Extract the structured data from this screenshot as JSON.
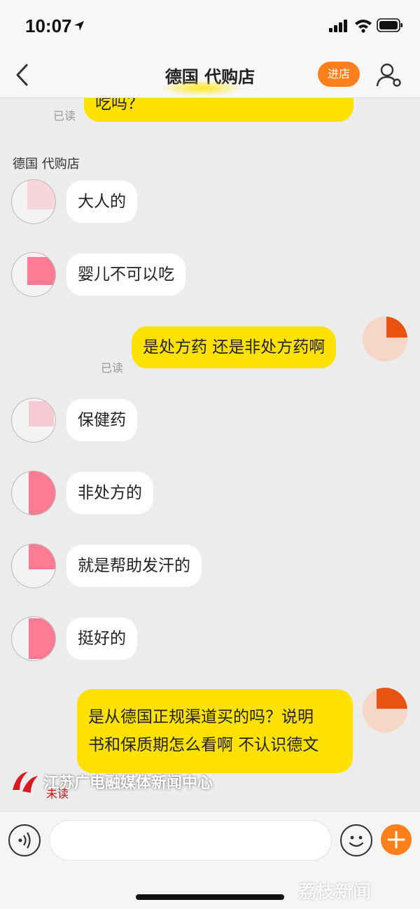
{
  "status_bar": {
    "time": "10:07"
  },
  "nav": {
    "title": "德国 代购店",
    "enter_store": "进店"
  },
  "chat": {
    "top_partial_text": "吃吗？",
    "read_label": "已读",
    "unread_label": "未读",
    "sender_name": "德国 代购店",
    "messages": [
      {
        "side": "in",
        "text": "大人的"
      },
      {
        "side": "in",
        "text": "婴儿不可以吃"
      },
      {
        "side": "out",
        "text": "是处方药 还是非处方药啊",
        "status": "已读"
      },
      {
        "side": "in",
        "text": "保健药"
      },
      {
        "side": "in",
        "text": "非处方的"
      },
      {
        "side": "in",
        "text": "就是帮助发汗的"
      },
      {
        "side": "in",
        "text": "挺好的"
      },
      {
        "side": "out",
        "text_line1": "是从德国正规渠道买的吗？说明",
        "text_line2": "书和保质期怎么看啊 不认识德文",
        "status": "未读"
      }
    ]
  },
  "watermark": {
    "text": "江苏广电融媒体新闻中心",
    "corner": "荔枝新闻"
  },
  "input_bar": {
    "message_placeholder": ""
  },
  "colors": {
    "accent": "#ff7f1a",
    "bubble_out": "#ffe100",
    "bubble_in": "#ffffff",
    "background": "#ececec"
  }
}
